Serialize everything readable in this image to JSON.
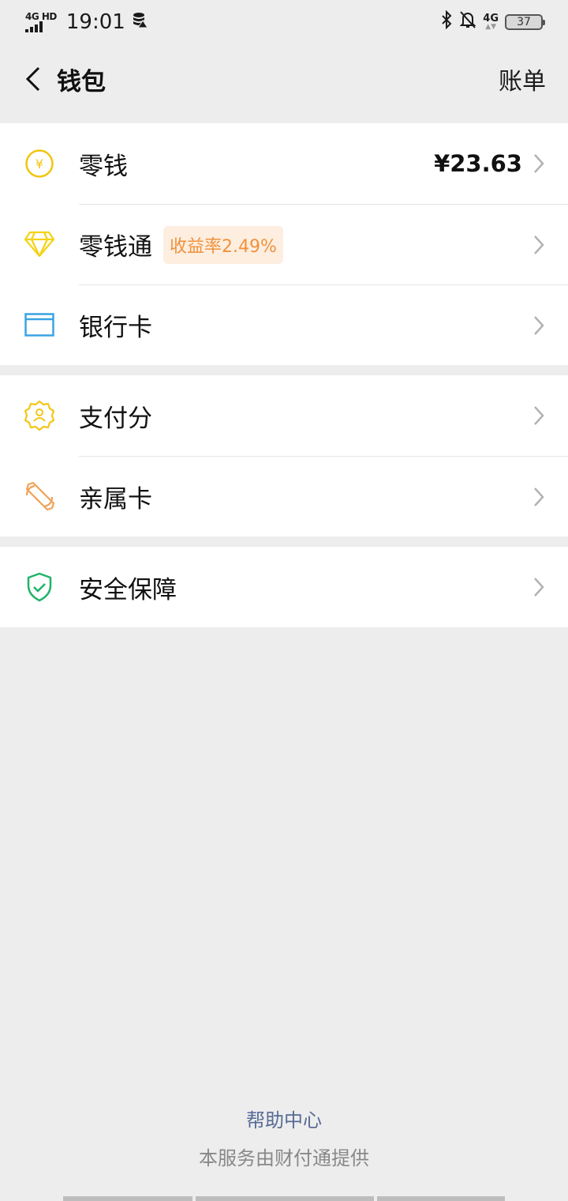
{
  "status_bar": {
    "signal_label": "4G HD",
    "time": "19:01",
    "network_badge": "4G",
    "battery": "37"
  },
  "header": {
    "title": "钱包",
    "right_action": "账单"
  },
  "group1": [
    {
      "label": "零钱",
      "value": "¥23.63"
    },
    {
      "label": "零钱通",
      "tag": "收益率2.49%"
    },
    {
      "label": "银行卡"
    }
  ],
  "group2": [
    {
      "label": "支付分"
    },
    {
      "label": "亲属卡"
    }
  ],
  "group3": [
    {
      "label": "安全保障"
    }
  ],
  "footer": {
    "help": "帮助中心",
    "provider": "本服务由财付通提供"
  },
  "colors": {
    "background": "#ededed",
    "link": "#576b95",
    "tag_text": "#f0923c",
    "tag_bg": "#fdeee0",
    "coin_icon": "#f2c40f",
    "diamond_icon": "#f5d315",
    "card_icon": "#3aa3e3",
    "score_icon": "#f5c518",
    "family_card_icon": "#f0a35b",
    "shield_icon": "#1fb36b"
  }
}
